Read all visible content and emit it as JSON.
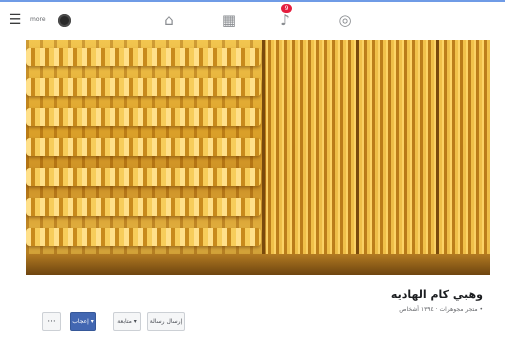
{
  "topbar": {
    "more_label": "more",
    "nav_icons": [
      "home-icon",
      "marketplace-icon",
      "notifications-icon",
      "more-icon"
    ],
    "notification_count": "9"
  },
  "page": {
    "name": "وهبي كام الهاديه",
    "meta": "• متجر مجوهرات · ١٣٩٤ أشخاص"
  },
  "actions": {
    "message_label": "إرسال رسالة",
    "follow_label": "متابعة ▾",
    "like_label": "إعجاب ▾",
    "more_label": "···"
  },
  "colors": {
    "accent": "#4267b2",
    "badge": "#e41e3f"
  }
}
